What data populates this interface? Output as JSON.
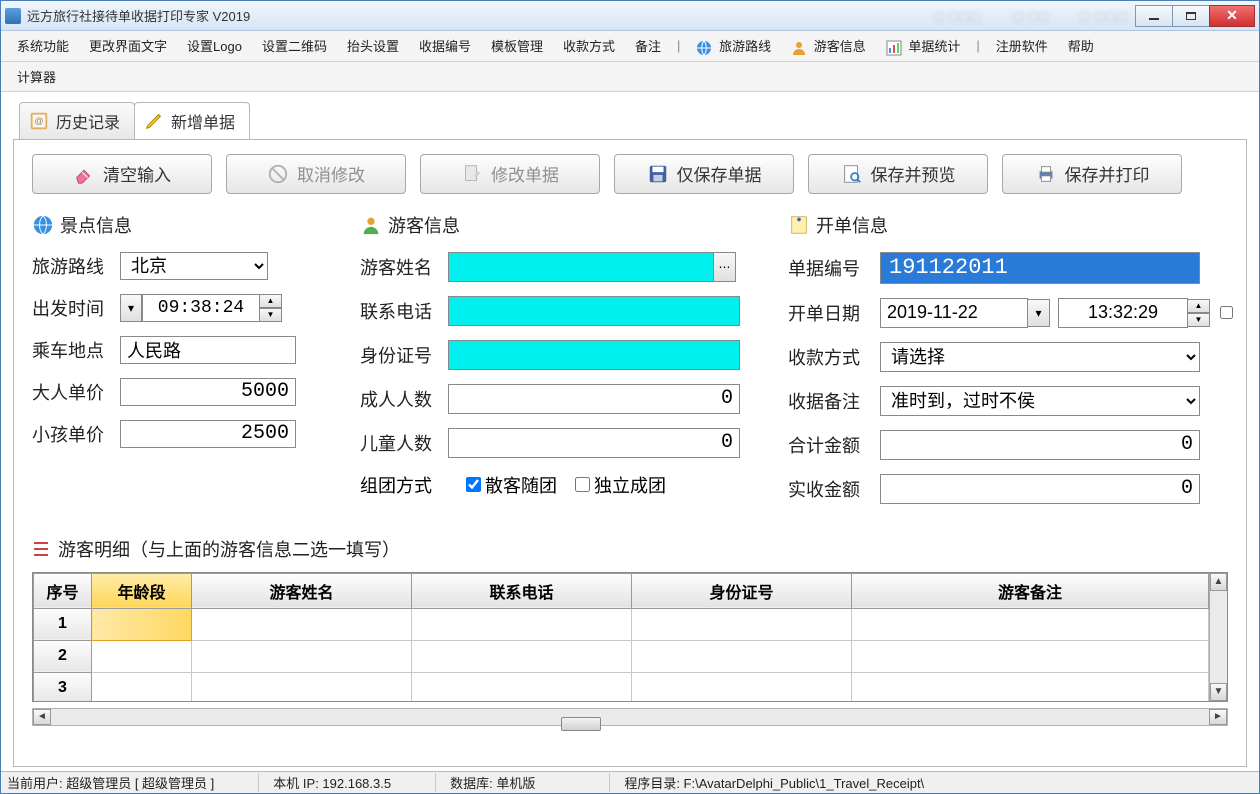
{
  "window": {
    "title": "远方旅行社接待单收据打印专家 V2019"
  },
  "menu": {
    "row1": [
      "系统功能",
      "更改界面文字",
      "设置Logo",
      "设置二维码",
      "抬头设置",
      "收据编号",
      "模板管理",
      "收款方式",
      "备注"
    ],
    "row1_icons": [
      {
        "label": "旅游路线",
        "icon": "globe"
      },
      {
        "label": "游客信息",
        "icon": "user"
      },
      {
        "label": "单据统计",
        "icon": "chart"
      }
    ],
    "row1_right": [
      "注册软件",
      "帮助"
    ],
    "row2": [
      "计算器"
    ]
  },
  "tabs": {
    "history": "历史记录",
    "newdoc": "新增单据"
  },
  "actions": {
    "clear": "清空输入",
    "cancel": "取消修改",
    "modify": "修改单据",
    "save": "仅保存单据",
    "preview": "保存并预览",
    "print": "保存并打印"
  },
  "section_scenic": {
    "title": "景点信息",
    "route_label": "旅游路线",
    "route_value": "北京",
    "depart_label": "出发时间",
    "depart_time": "09:38:24",
    "board_label": "乘车地点",
    "board_value": "人民路",
    "adult_label": "大人单价",
    "adult_value": "5000",
    "child_label": "小孩单价",
    "child_value": "2500"
  },
  "section_tourist": {
    "title": "游客信息",
    "name_label": "游客姓名",
    "name_value": "",
    "phone_label": "联系电话",
    "phone_value": "",
    "id_label": "身份证号",
    "id_value": "",
    "adults_label": "成人人数",
    "adults_value": "0",
    "children_label": "儿童人数",
    "children_value": "0",
    "group_label": "组团方式",
    "group_opt1": "散客随团",
    "group_opt2": "独立成团"
  },
  "section_invoice": {
    "title": "开单信息",
    "no_label": "单据编号",
    "no_value": "191122011",
    "date_label": "开单日期",
    "date_value": "2019-11-22",
    "time_value": "13:32:29",
    "paymethod_label": "收款方式",
    "paymethod_value": "请选择",
    "remark_label": "收据备注",
    "remark_value": "准时到，过时不侯",
    "total_label": "合计金额",
    "total_value": "0",
    "received_label": "实收金额",
    "received_value": "0"
  },
  "detail": {
    "title": "游客明细（与上面的游客信息二选一填写）",
    "cols": {
      "seq": "序号",
      "age": "年龄段",
      "name": "游客姓名",
      "phone": "联系电话",
      "id": "身份证号",
      "remark": "游客备注"
    },
    "rows": [
      {
        "seq": "1",
        "age": "",
        "name": "",
        "phone": "",
        "id": "",
        "remark": ""
      },
      {
        "seq": "2",
        "age": "",
        "name": "",
        "phone": "",
        "id": "",
        "remark": ""
      },
      {
        "seq": "3",
        "age": "",
        "name": "",
        "phone": "",
        "id": "",
        "remark": ""
      }
    ]
  },
  "status": {
    "user": "当前用户: 超级管理员 [ 超级管理员 ]",
    "ip": "本机 IP: 192.168.3.5",
    "db": "数据库: 单机版",
    "dir": "程序目录: F:\\AvatarDelphi_Public\\1_Travel_Receipt\\"
  }
}
